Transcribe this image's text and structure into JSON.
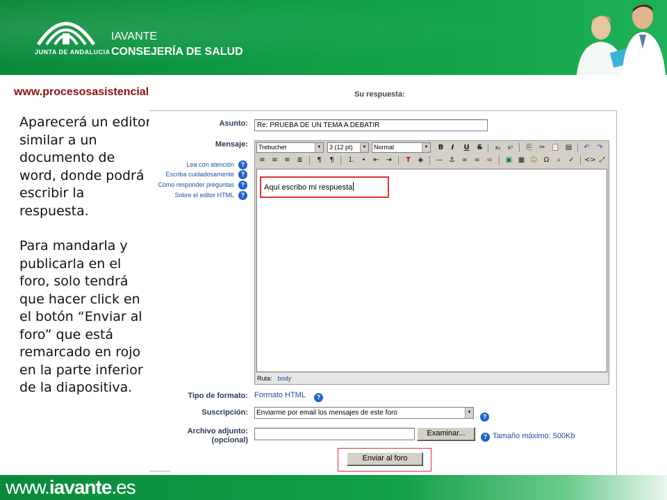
{
  "header": {
    "logo_text": "JUNTA DE ANDALUCIA",
    "org_line1": "IAVANTE",
    "org_line2": "CONSEJERÍA DE SALUD"
  },
  "site_url": "www.procesosasistenciales.com",
  "explanation": {
    "para1": "Aparecerá un editor similar a un documento de word, donde podrá escribir la respuesta.",
    "para2": "Para mandarla y publicarla en el foro, solo tendrá que hacer click en el botón “Enviar al foro” que está remarcado en rojo en la parte inferior de la diapositiva."
  },
  "form": {
    "heading": "Su respuesta:",
    "subject_label": "Asunto:",
    "subject_value": "Re: PRUEBA DE UN TEMA A DEBATIR",
    "message_label": "Mensaje:",
    "help_links": [
      "Lea con atención",
      "Escriba cuidadosamente",
      "Cómo responder preguntas",
      "Sobre el editor HTML"
    ],
    "font_select": "Trebuchet",
    "size_select": "3 (12 pt)",
    "style_select": "Normal",
    "editor_text": "Aquí escribo mi respuesta",
    "path_label": "Ruta:",
    "path_value": "body",
    "format_label": "Tipo de formato:",
    "format_value": "Formato HTML",
    "subscription_label": "Suscripción:",
    "subscription_value": "Enviarme por email los mensajes de este foro",
    "attachment_label": "Archivo adjunto:",
    "attachment_label2": "(opcional)",
    "browse_button": "Examinar...",
    "max_size": "Tamaño máximo: 500Kb",
    "submit_button": "Enviar al foro"
  },
  "footer": {
    "text_pre": "www.",
    "text_bold": "iavante",
    "text_post": ".es"
  },
  "colors": {
    "header_green": "#0f9b45",
    "url_red": "#8b1010",
    "highlight_red": "#e03030",
    "link_blue": "#1a4fa0"
  }
}
